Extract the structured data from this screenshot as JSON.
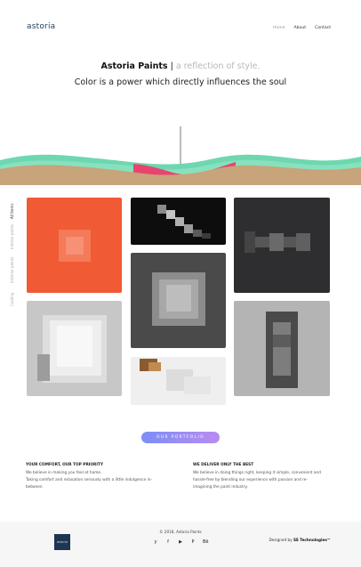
{
  "header": {
    "logo": "astoria",
    "nav": [
      {
        "label": "Home"
      },
      {
        "label": "About"
      },
      {
        "label": "Contact"
      }
    ]
  },
  "hero": {
    "brand": "Astoria Paints",
    "separator": "|",
    "tagline": "a reflection of style.",
    "subtitle": "Color is a power which directly influences the soul"
  },
  "filters": [
    "All Items",
    "Interior paints",
    "Exterior paints",
    "Coating"
  ],
  "portfolio_button": "OUR PORTFOLIO",
  "info": [
    {
      "title": "YOUR COMFORT, OUR TOP PRIORITY",
      "lines": [
        "We believe in making you feel at home.",
        "Taking comfort and relaxation seriously with a little indulgence in-",
        "between"
      ]
    },
    {
      "title": "WE DELIVER ONLY THE BEST",
      "lines": [
        "We believe in doing things right, keeping it simple, convenient and",
        "hassle-free by blending our experience with passion and re-",
        "imagining the paint industry."
      ]
    }
  ],
  "footer": {
    "logo": "astoria",
    "copyright": "© 2018, Astoria Paints",
    "social": [
      "twitter-icon",
      "facebook-icon",
      "youtube-icon",
      "pinterest-icon",
      "behance-icon"
    ],
    "social_glyphs": [
      "y",
      "f",
      "▶",
      "P",
      "Bē"
    ],
    "credit_prefix": "Designed by",
    "credit_name": "SS Technologies™"
  },
  "colors": {
    "accent_orange": "#f05a35",
    "wave_teal": "#6ed7b0",
    "wave_pink": "#e8456e",
    "wave_sand": "#c7a47a",
    "logo_navy": "#1f3a5f"
  }
}
